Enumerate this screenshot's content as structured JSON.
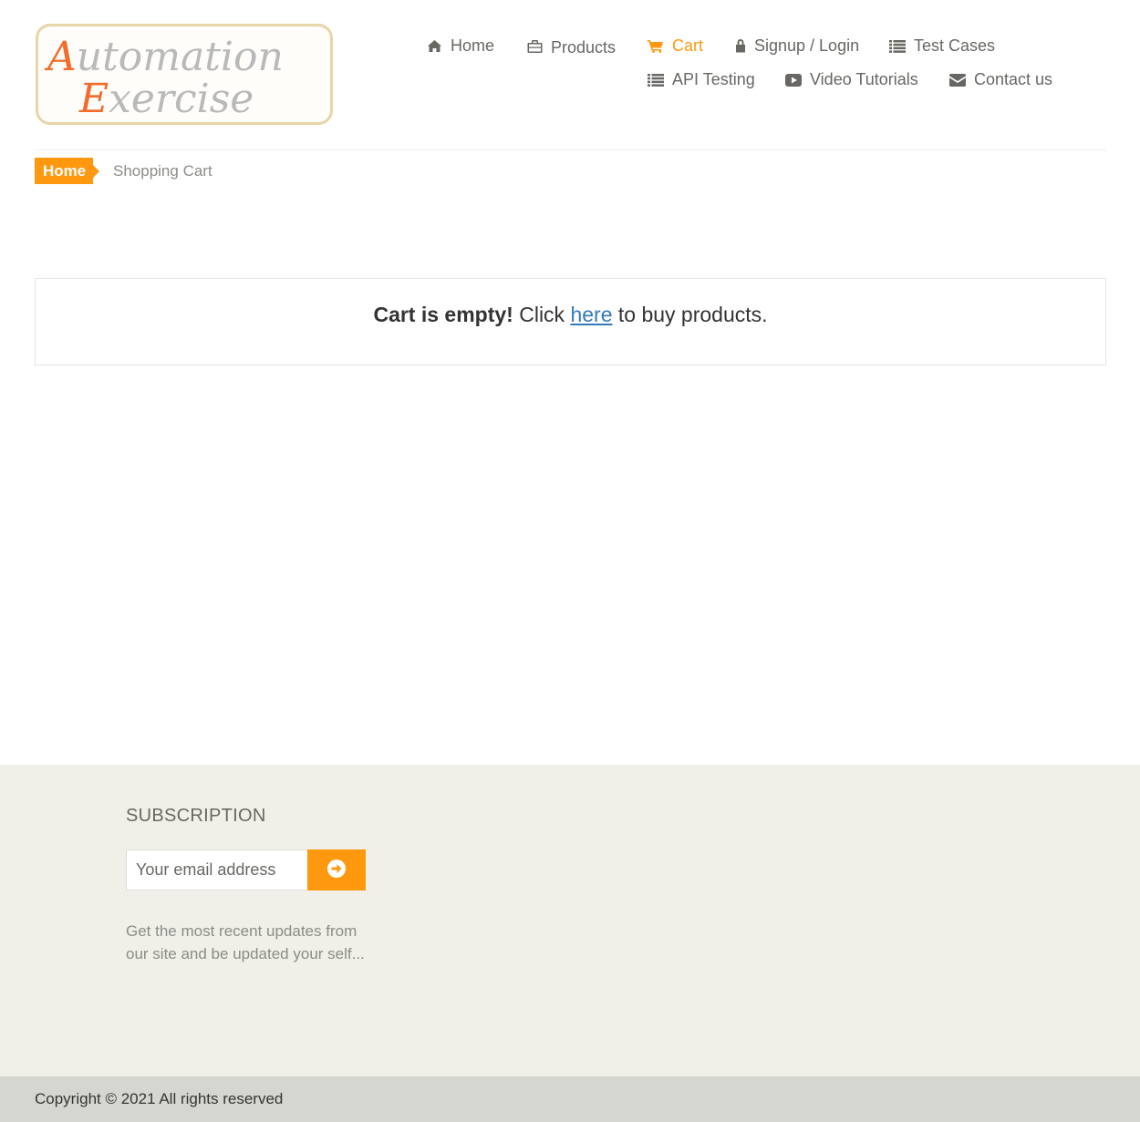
{
  "logo": {
    "line1": "Automation",
    "line2": "Exercise"
  },
  "nav": {
    "items": [
      {
        "label": "Home",
        "icon": "home-icon"
      },
      {
        "label": "Products",
        "icon": "briefcase-icon"
      },
      {
        "label": "Cart",
        "icon": "shopping-cart-icon",
        "active": true
      },
      {
        "label": "Signup / Login",
        "icon": "lock-icon"
      },
      {
        "label": "Test Cases",
        "icon": "list-icon"
      },
      {
        "label": "API Testing",
        "icon": "list-icon"
      },
      {
        "label": "Video Tutorials",
        "icon": "youtube-play-icon"
      },
      {
        "label": "Contact us",
        "icon": "envelope-icon"
      }
    ]
  },
  "breadcrumb": {
    "home": "Home",
    "current": "Shopping Cart"
  },
  "cart": {
    "empty_bold": "Cart is empty!",
    "click_text": "Click",
    "link_text": "here",
    "suffix_text": "to buy products."
  },
  "footer": {
    "subscription_title": "SUBSCRIPTION",
    "email_placeholder": "Your email address",
    "subscribe_icon": "arrow-circle-right-icon",
    "description": "Get the most recent updates from our site and be updated your self...",
    "copyright": "Copyright © 2021 All rights reserved"
  },
  "colors": {
    "accent": "#fe980f",
    "nav_text": "#696763",
    "link": "#337ab7",
    "footer_bg": "#f0f0e9",
    "footer_bottom_bg": "#d6d6d0"
  }
}
